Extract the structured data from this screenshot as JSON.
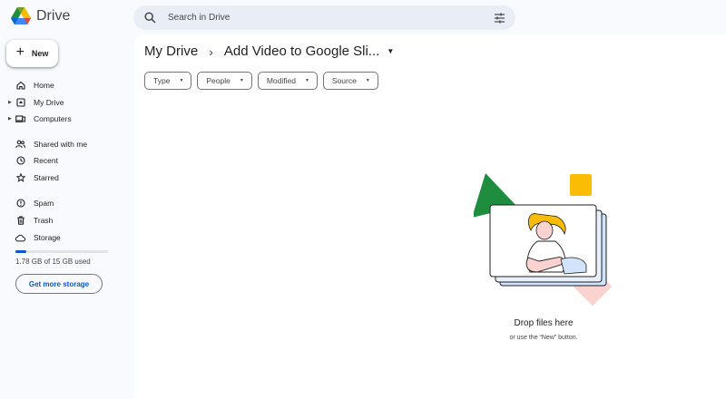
{
  "app": {
    "name": "Drive"
  },
  "search": {
    "placeholder": "Search in Drive"
  },
  "new_button": {
    "label": "New"
  },
  "sidebar": {
    "items": [
      {
        "label": "Home",
        "icon": "home-icon"
      },
      {
        "label": "My Drive",
        "icon": "my-drive-icon"
      },
      {
        "label": "Computers",
        "icon": "computers-icon"
      },
      {
        "label": "Shared with me",
        "icon": "shared-icon"
      },
      {
        "label": "Recent",
        "icon": "clock-icon"
      },
      {
        "label": "Starred",
        "icon": "star-icon"
      },
      {
        "label": "Spam",
        "icon": "spam-icon"
      },
      {
        "label": "Trash",
        "icon": "trash-icon"
      },
      {
        "label": "Storage",
        "icon": "cloud-icon"
      }
    ]
  },
  "storage": {
    "used_text": "1.78 GB of 15 GB used",
    "used_fraction": 0.12,
    "cta": "Get more storage"
  },
  "breadcrumb": {
    "root": "My Drive",
    "separator": "›",
    "current": "Add Video to Google Sli..."
  },
  "filters": [
    "Type",
    "People",
    "Modified",
    "Source"
  ],
  "empty_state": {
    "title": "Drop files here",
    "subtitle": "or use the “New” button."
  },
  "colors": {
    "accent": "#0b57d0",
    "background": "#f8fafd",
    "search_bg": "#e9eef6",
    "drive_green": "#1e8e3e",
    "drive_yellow": "#fbbc04",
    "drive_blue": "#4285f4",
    "drive_red": "#ea4335"
  }
}
